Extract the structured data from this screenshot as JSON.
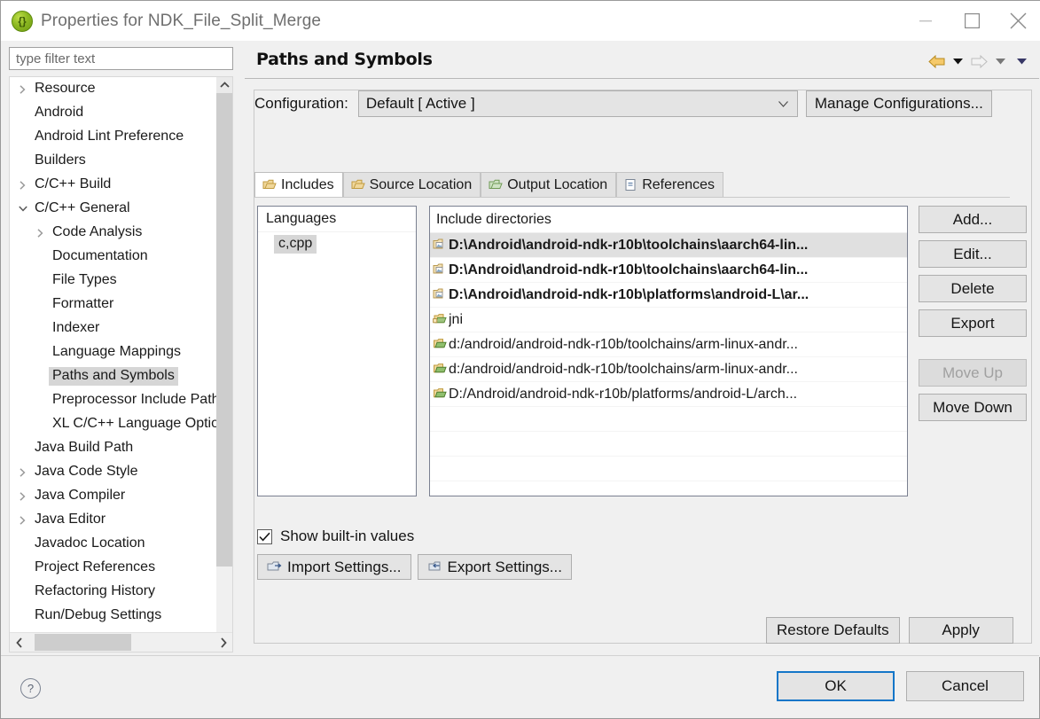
{
  "window": {
    "title": "Properties for NDK_File_Split_Merge",
    "app_icon": "eclipse-icon",
    "minimize_label": "—",
    "maximize_label": "□",
    "close_label": "✕"
  },
  "filter": {
    "placeholder": "type filter text",
    "value": "type filter text"
  },
  "tree": {
    "items": [
      {
        "label": "Resource",
        "indent": 0,
        "arrow": "collapsed",
        "selected": false
      },
      {
        "label": "Android",
        "indent": 0,
        "arrow": "none",
        "selected": false
      },
      {
        "label": "Android Lint Preference",
        "indent": 0,
        "arrow": "none",
        "selected": false
      },
      {
        "label": "Builders",
        "indent": 0,
        "arrow": "none",
        "selected": false
      },
      {
        "label": "C/C++ Build",
        "indent": 0,
        "arrow": "collapsed",
        "selected": false
      },
      {
        "label": "C/C++ General",
        "indent": 0,
        "arrow": "expanded",
        "selected": false
      },
      {
        "label": "Code Analysis",
        "indent": 1,
        "arrow": "collapsed",
        "selected": false
      },
      {
        "label": "Documentation",
        "indent": 1,
        "arrow": "none",
        "selected": false
      },
      {
        "label": "File Types",
        "indent": 1,
        "arrow": "none",
        "selected": false
      },
      {
        "label": "Formatter",
        "indent": 1,
        "arrow": "none",
        "selected": false
      },
      {
        "label": "Indexer",
        "indent": 1,
        "arrow": "none",
        "selected": false
      },
      {
        "label": "Language Mappings",
        "indent": 1,
        "arrow": "none",
        "selected": false
      },
      {
        "label": "Paths and Symbols",
        "indent": 1,
        "arrow": "none",
        "selected": true
      },
      {
        "label": "Preprocessor Include Paths",
        "indent": 1,
        "arrow": "none",
        "selected": false
      },
      {
        "label": "XL C/C++ Language Options",
        "indent": 1,
        "arrow": "none",
        "selected": false
      },
      {
        "label": "Java Build Path",
        "indent": 0,
        "arrow": "none",
        "selected": false
      },
      {
        "label": "Java Code Style",
        "indent": 0,
        "arrow": "collapsed",
        "selected": false
      },
      {
        "label": "Java Compiler",
        "indent": 0,
        "arrow": "collapsed",
        "selected": false
      },
      {
        "label": "Java Editor",
        "indent": 0,
        "arrow": "collapsed",
        "selected": false
      },
      {
        "label": "Javadoc Location",
        "indent": 0,
        "arrow": "none",
        "selected": false
      },
      {
        "label": "Project References",
        "indent": 0,
        "arrow": "none",
        "selected": false
      },
      {
        "label": "Refactoring History",
        "indent": 0,
        "arrow": "none",
        "selected": false
      },
      {
        "label": "Run/Debug Settings",
        "indent": 0,
        "arrow": "none",
        "selected": false
      }
    ]
  },
  "page": {
    "title": "Paths and Symbols",
    "nav": {
      "back_icon": "back-arrow-icon",
      "back_dropdown_icon": "chevron-down-icon",
      "forward_icon": "forward-arrow-icon",
      "forward_dropdown_icon": "chevron-down-icon",
      "menu_dropdown_icon": "chevron-down-icon"
    }
  },
  "configuration": {
    "label": "Configuration:",
    "value": "Default  [ Active ]",
    "manage_button": "Manage Configurations...",
    "caret_icon": "chevron-down-icon"
  },
  "tabs": [
    {
      "label": "Includes",
      "icon": "include-folder-icon",
      "active": true
    },
    {
      "label": "Source Location",
      "icon": "source-folder-icon",
      "active": false
    },
    {
      "label": "Output Location",
      "icon": "output-folder-icon",
      "active": false
    },
    {
      "label": "References",
      "icon": "references-icon",
      "active": false
    }
  ],
  "languages": {
    "header": "Languages",
    "items": [
      {
        "label": "c,cpp",
        "selected": true
      }
    ]
  },
  "include_directories": {
    "header": "Include directories",
    "rows": [
      {
        "text": "D:\\Android\\android-ndk-r10b\\toolchains\\aarch64-lin...",
        "icon": "builtin-include-folder-icon",
        "bold": true,
        "selected": true
      },
      {
        "text": "D:\\Android\\android-ndk-r10b\\toolchains\\aarch64-lin...",
        "icon": "builtin-include-folder-icon",
        "bold": true,
        "selected": false
      },
      {
        "text": "D:\\Android\\android-ndk-r10b\\platforms\\android-L\\ar...",
        "icon": "builtin-include-folder-icon",
        "bold": true,
        "selected": false
      },
      {
        "text": "jni",
        "icon": "workspace-include-folder-icon",
        "bold": false,
        "selected": false
      },
      {
        "text": "d:/android/android-ndk-r10b/toolchains/arm-linux-andr...",
        "icon": "include-folder-icon",
        "bold": false,
        "selected": false
      },
      {
        "text": "d:/android/android-ndk-r10b/toolchains/arm-linux-andr...",
        "icon": "include-folder-icon",
        "bold": false,
        "selected": false
      },
      {
        "text": "D:/Android/android-ndk-r10b/platforms/android-L/arch...",
        "icon": "include-folder-icon",
        "bold": false,
        "selected": false
      }
    ],
    "empty_rows": 4
  },
  "side_buttons": [
    {
      "label": "Add...",
      "enabled": true
    },
    {
      "label": "Edit...",
      "enabled": true
    },
    {
      "label": "Delete",
      "enabled": true
    },
    {
      "label": "Export",
      "enabled": true
    },
    {
      "label": "Move Up",
      "enabled": false
    },
    {
      "label": "Move Down",
      "enabled": true
    }
  ],
  "show_builtin": {
    "label": "Show built-in values",
    "checked": true,
    "check_icon": "checkmark-icon"
  },
  "settings_buttons": [
    {
      "label": "Import Settings...",
      "icon": "import-icon"
    },
    {
      "label": "Export Settings...",
      "icon": "export-icon"
    }
  ],
  "panel_buttons": {
    "restore_defaults": "Restore Defaults",
    "apply": "Apply"
  },
  "footer": {
    "help_icon": "help-question-icon",
    "help_label": "?",
    "ok": "OK",
    "cancel": "Cancel"
  }
}
